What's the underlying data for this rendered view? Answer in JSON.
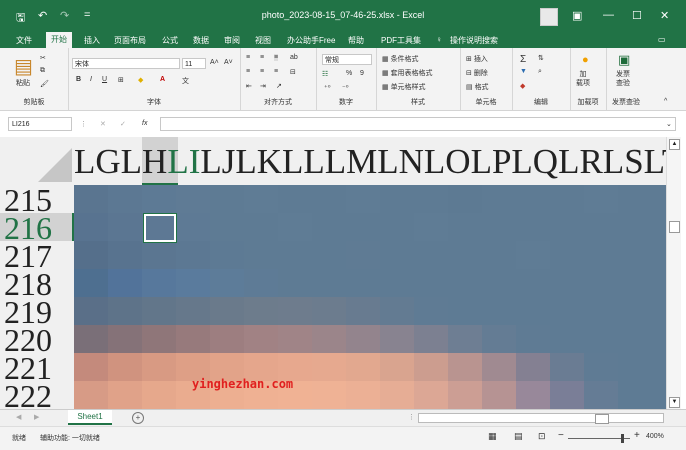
{
  "window": {
    "title": "photo_2023-08-15_07-46-25.xlsx  -  Excel",
    "controls": {
      "restore": "▣",
      "minimize": "—",
      "maximize": "☐",
      "close": "✕"
    },
    "quick_access": {
      "save": "🖫",
      "undo": "↶",
      "redo": "↷",
      "customize": "="
    }
  },
  "menu": {
    "items": [
      "文件",
      "开始",
      "插入",
      "页面布局",
      "公式",
      "数据",
      "审阅",
      "视图",
      "办公助手Free",
      "帮助",
      "PDF工具集"
    ],
    "active": "开始",
    "search_label": "操作说明搜索",
    "share_icon": "▭"
  },
  "ribbon": {
    "clipboard": {
      "paste": "粘贴",
      "label": "剪贴板"
    },
    "font": {
      "name": "宋体",
      "size": "11",
      "grow": "A˄",
      "shrink": "A˅",
      "bold": "B",
      "italic": "I",
      "underline": "U",
      "label": "字体"
    },
    "alignment": {
      "label": "对齐方式"
    },
    "number": {
      "format": "常规",
      "percent": "%",
      "comma": "9",
      "label": "数字"
    },
    "styles": {
      "conditional": "条件格式",
      "table": "套用表格格式",
      "cell": "单元格样式",
      "label": "样式"
    },
    "cells": {
      "insert": "插入",
      "delete": "删除",
      "format": "格式",
      "label": "单元格"
    },
    "editing": {
      "sum": "Σ",
      "label": "编辑"
    },
    "addins": {
      "button": "加\n载项",
      "label": "加载项"
    },
    "invoice": {
      "button": "发票\n查验",
      "label": "发票查验"
    }
  },
  "formula_bar": {
    "name_box": "LI216",
    "fx": "fx",
    "value": ""
  },
  "sheet": {
    "column_headers_text": "LGLHLILJLKLLLMLNLOLPLQLRLSLTLULVLW",
    "selected_column": "LI",
    "row_labels": [
      "215",
      "216",
      "217",
      "218",
      "219",
      "220",
      "221",
      "222"
    ],
    "selected_row": "216",
    "watermark": "yinghezhan.com",
    "colors": {
      "base": "#5e7b94",
      "accent": "#217346",
      "warm": "#e8a486"
    }
  },
  "tabs": {
    "sheet_name": "Sheet1",
    "add_label": "+"
  },
  "status": {
    "ready": "就绪",
    "accessibility": "辅助功能: 一切就绪",
    "zoom": "400%",
    "view_icons": [
      "normal-view-icon",
      "page-layout-icon",
      "page-break-icon"
    ]
  }
}
